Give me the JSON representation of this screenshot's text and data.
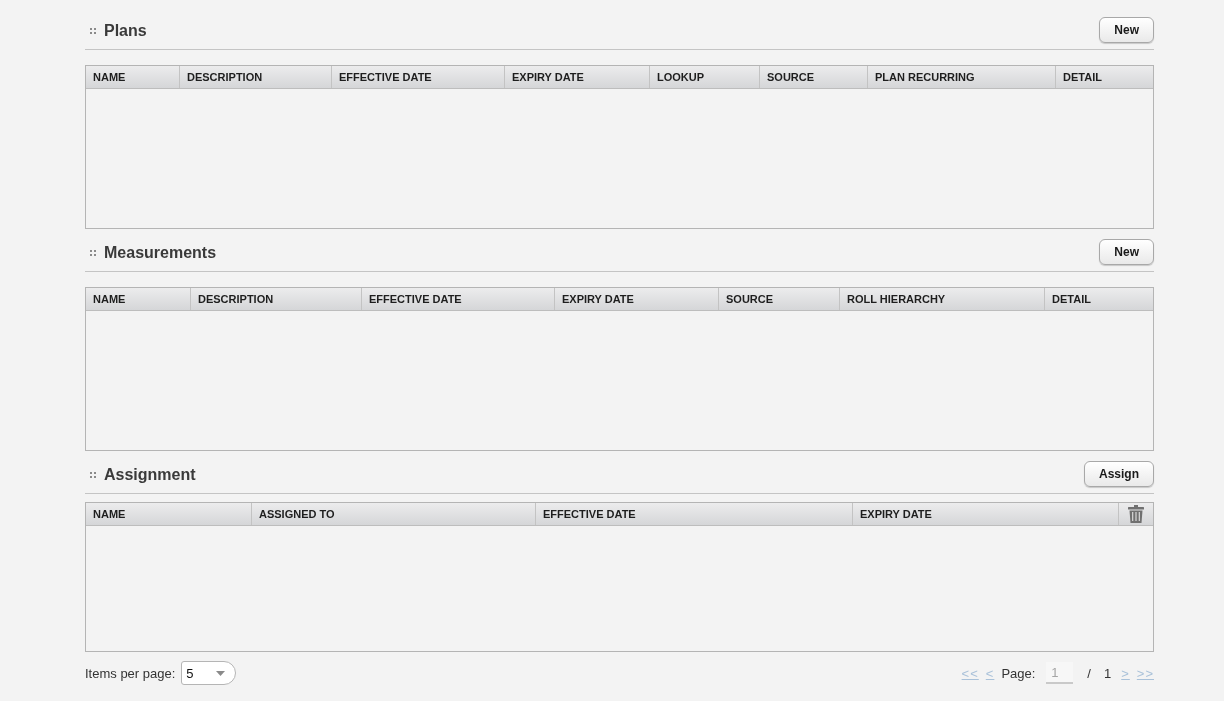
{
  "sections": [
    {
      "title": "Plans",
      "button": "New",
      "table": {
        "columns": [
          "NAME",
          "DESCRIPTION",
          "EFFECTIVE DATE",
          "EXPIRY DATE",
          "LOOKUP",
          "SOURCE",
          "PLAN RECURRING",
          "DETAIL"
        ]
      }
    },
    {
      "title": "Measurements",
      "button": "New",
      "table": {
        "columns": [
          "NAME",
          "DESCRIPTION",
          "EFFECTIVE DATE",
          "EXPIRY DATE",
          "SOURCE",
          "ROLL HIERARCHY",
          "DETAIL"
        ]
      }
    },
    {
      "title": "Assignment",
      "button": "Assign",
      "table": {
        "columns": [
          "NAME",
          "ASSIGNED TO",
          "EFFECTIVE DATE",
          "EXPIRY DATE"
        ],
        "delete_column": true
      }
    }
  ],
  "footer": {
    "items_per_page": {
      "label": "Items per page:",
      "value": "5"
    },
    "pagination": {
      "first": {
        "label": "<<",
        "disabled": true
      },
      "previous": {
        "label": "<",
        "disabled": true
      },
      "page_label": "Page:",
      "page_input": {
        "value": "1",
        "disabled": true
      },
      "separator": "/",
      "total_pages": "1",
      "next": {
        "label": ">",
        "disabled": true
      },
      "last": {
        "label": ">>",
        "disabled": true
      }
    }
  }
}
